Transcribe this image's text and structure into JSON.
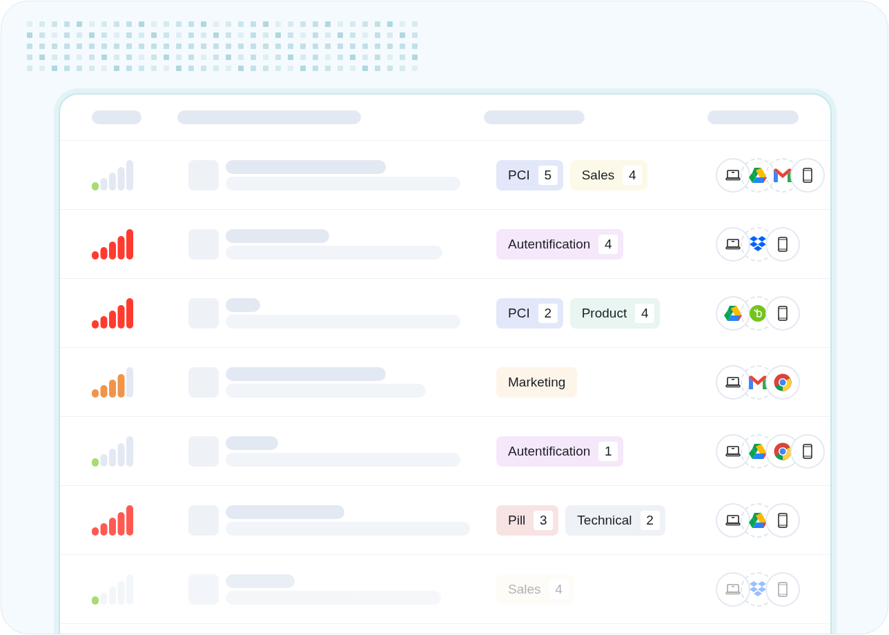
{
  "rows": [
    {
      "level": 0.2,
      "color": "#a6dc72",
      "faded": false,
      "tags": [
        {
          "label": "PCI",
          "count": "5",
          "color": "#e2e8fa"
        },
        {
          "label": "Sales",
          "count": "4",
          "color": "#fdf9e8"
        }
      ],
      "apps": [
        {
          "kind": "laptop",
          "dashed": false
        },
        {
          "kind": "drive",
          "dashed": true
        },
        {
          "kind": "gmail",
          "dashed": true
        },
        {
          "kind": "phone",
          "dashed": false
        }
      ]
    },
    {
      "level": 1,
      "color": "#ff3b30",
      "faded": false,
      "tags": [
        {
          "label": "Autentification",
          "count": "4",
          "color": "#f5e8fb"
        }
      ],
      "apps": [
        {
          "kind": "laptop",
          "dashed": false
        },
        {
          "kind": "dropbox",
          "dashed": true
        },
        {
          "kind": "phone",
          "dashed": false
        }
      ]
    },
    {
      "level": 1,
      "color": "#ff3b30",
      "faded": false,
      "tags": [
        {
          "label": "PCI",
          "count": "2",
          "color": "#e2e8fa"
        },
        {
          "label": "Product",
          "count": "4",
          "color": "#e8f5f1"
        }
      ],
      "apps": [
        {
          "kind": "drive",
          "dashed": false
        },
        {
          "kind": "bamboo",
          "dashed": true
        },
        {
          "kind": "phone",
          "dashed": false
        }
      ]
    },
    {
      "level": 0.8,
      "color": "#f0944a",
      "faded": false,
      "tags": [
        {
          "label": "Marketing",
          "color": "#fdf5ea"
        }
      ],
      "apps": [
        {
          "kind": "laptop",
          "dashed": false
        },
        {
          "kind": "gmail",
          "dashed": true
        },
        {
          "kind": "chrome",
          "dashed": false
        }
      ]
    },
    {
      "level": 0.2,
      "color": "#a6dc72",
      "faded": false,
      "tags": [
        {
          "label": "Autentification",
          "count": "1",
          "color": "#f5e8fb"
        }
      ],
      "apps": [
        {
          "kind": "laptop",
          "dashed": false
        },
        {
          "kind": "drive",
          "dashed": true
        },
        {
          "kind": "chrome",
          "dashed": false
        },
        {
          "kind": "phone",
          "dashed": false
        }
      ]
    },
    {
      "level": 1,
      "color": "#ff5a52",
      "faded": false,
      "tags": [
        {
          "label": "Pill",
          "count": "3",
          "color": "#f8e3e3"
        },
        {
          "label": "Technical",
          "count": "2",
          "color": "#eef1f5"
        }
      ],
      "apps": [
        {
          "kind": "laptop",
          "dashed": false
        },
        {
          "kind": "drive",
          "dashed": true
        },
        {
          "kind": "phone",
          "dashed": false
        }
      ]
    },
    {
      "level": 0.2,
      "color": "#a6dc72",
      "faded": true,
      "tags": [
        {
          "label": "Sales",
          "count": "4",
          "color": "#fdf9e8"
        }
      ],
      "apps": [
        {
          "kind": "laptop",
          "dashed": false
        },
        {
          "kind": "dropbox",
          "dashed": true
        },
        {
          "kind": "phone",
          "dashed": false
        }
      ]
    }
  ]
}
